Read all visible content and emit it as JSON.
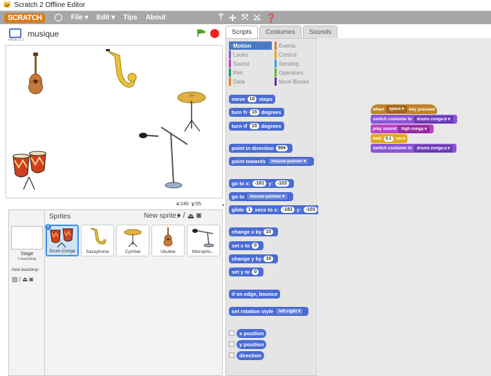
{
  "window": {
    "title": "Scratch 2 Offline Editor"
  },
  "menubar": {
    "logo": "SCRATCH",
    "file": "File ▾",
    "edit": "Edit ▾",
    "tips": "Tips",
    "about": "About"
  },
  "stage": {
    "project_title": "musique",
    "version": "v456.0.1",
    "x_label": "x:",
    "x_value": "240",
    "y_label": "y:",
    "y_value": "55"
  },
  "sprites_panel": {
    "label": "Sprites",
    "new_sprite_label": "New sprite:",
    "stage_label": "Stage",
    "stage_sub": "1 backdrop",
    "new_backdrop_label": "New backdrop:",
    "sprites": [
      {
        "name": "Drum-Conga",
        "selected": true
      },
      {
        "name": "Saxophone"
      },
      {
        "name": "Cymbal"
      },
      {
        "name": "Ukulele"
      },
      {
        "name": "Micropho..."
      }
    ]
  },
  "tabs": [
    {
      "label": "Scripts",
      "active": true
    },
    {
      "label": "Costumes"
    },
    {
      "label": "Sounds"
    }
  ],
  "categories": [
    {
      "label": "Motion",
      "color": "#4a6cd4",
      "active": true
    },
    {
      "label": "Looks",
      "color": "#8a55d7"
    },
    {
      "label": "Sound",
      "color": "#bb42c3"
    },
    {
      "label": "Pen",
      "color": "#0e9a6c"
    },
    {
      "label": "Data",
      "color": "#ee7d16"
    },
    {
      "label": "Events",
      "color": "#c88330"
    },
    {
      "label": "Control",
      "color": "#e1a91a"
    },
    {
      "label": "Sensing",
      "color": "#2ca5e2"
    },
    {
      "label": "Operators",
      "color": "#5cb712"
    },
    {
      "label": "More Blocks",
      "color": "#632d99"
    }
  ],
  "palette_blocks": {
    "move": {
      "pre": "move",
      "val": "10",
      "post": "steps"
    },
    "turn_right": {
      "pre": "turn ↻",
      "val": "15",
      "post": "degrees"
    },
    "turn_left": {
      "pre": "turn ↺",
      "val": "15",
      "post": "degrees"
    },
    "point_direction": {
      "pre": "point in direction",
      "val": "90▾"
    },
    "point_towards": {
      "pre": "point towards",
      "val": "mouse-pointer ▾"
    },
    "goto_xy": {
      "pre": "go to x:",
      "x": "-181",
      "mid": "y:",
      "y": "-103"
    },
    "goto": {
      "pre": "go to",
      "val": "mouse-pointer ▾"
    },
    "glide": {
      "pre": "glide",
      "secs": "1",
      "mid": "secs to x:",
      "x": "-181",
      "mid2": "y:",
      "y": "-103"
    },
    "change_x": {
      "pre": "change x by",
      "val": "10"
    },
    "set_x": {
      "pre": "set x to",
      "val": "0"
    },
    "change_y": {
      "pre": "change y by",
      "val": "10"
    },
    "set_y": {
      "pre": "set y to",
      "val": "0"
    },
    "bounce": {
      "label": "if on edge, bounce"
    },
    "rotation_style": {
      "pre": "set rotation style",
      "val": "left-right ▾"
    },
    "x_position": {
      "label": "x position"
    },
    "y_position": {
      "label": "y position"
    },
    "direction": {
      "label": "direction"
    }
  },
  "script": {
    "when_key": {
      "pre": "when",
      "key": "space ▾",
      "post": "key pressed"
    },
    "switch1": {
      "pre": "switch costume to",
      "val": "drums conga-b ▾"
    },
    "play_sound": {
      "pre": "play sound",
      "val": "high conga ▾"
    },
    "wait": {
      "pre": "wait",
      "val": "0.1",
      "post": "secs"
    },
    "switch2": {
      "pre": "switch costume to",
      "val": "drums conga-a ▾"
    }
  }
}
